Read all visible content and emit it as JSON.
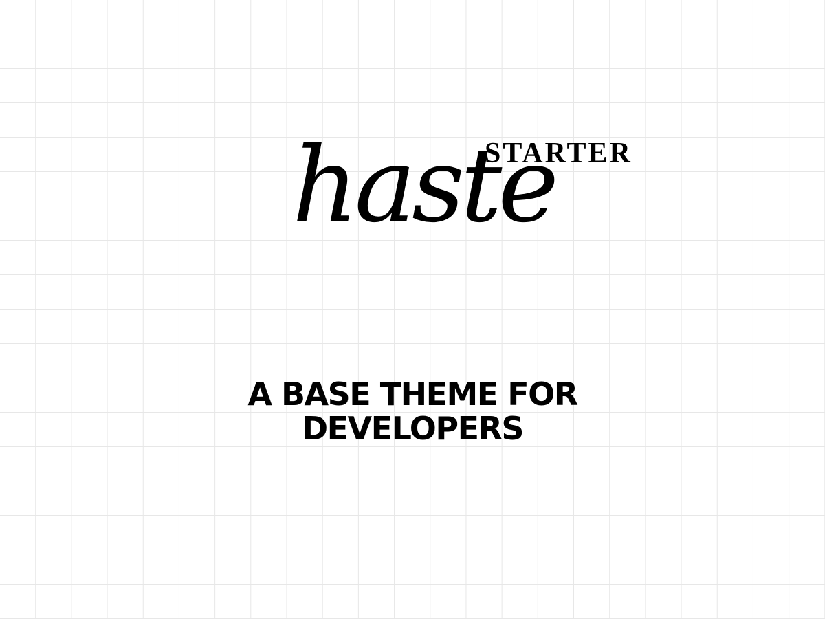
{
  "logo": {
    "wordmark": "haste",
    "superscript": "STARTER"
  },
  "tagline": {
    "line1": "A BASE THEME FOR",
    "line2": "DEVELOPERS"
  },
  "colors": {
    "background": "#ffffff",
    "grid": "#e7e7e7",
    "text": "#000000"
  }
}
